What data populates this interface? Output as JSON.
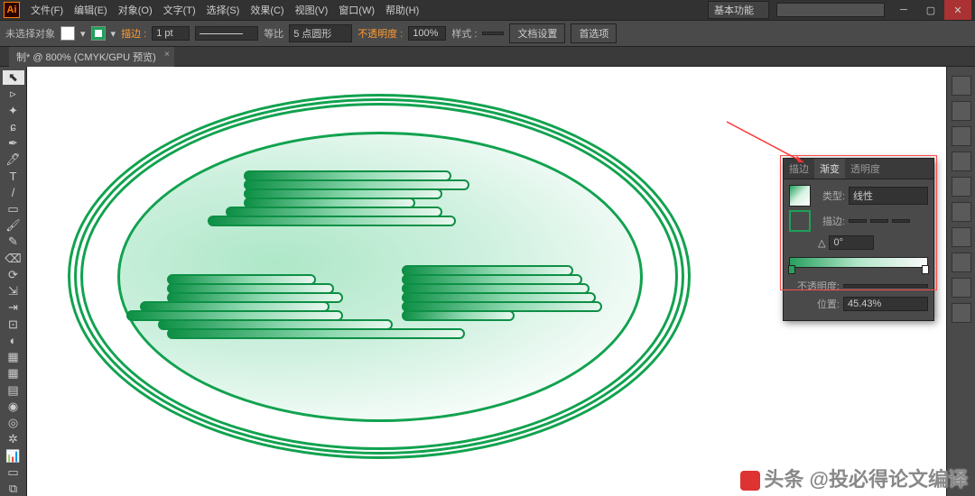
{
  "app": {
    "logo": "Ai"
  },
  "menu": [
    "文件(F)",
    "编辑(E)",
    "对象(O)",
    "文字(T)",
    "选择(S)",
    "效果(C)",
    "视图(V)",
    "窗口(W)",
    "帮助(H)"
  ],
  "workspace": "基本功能",
  "ctrlbar": {
    "no_selection": "未选择对象",
    "stroke_lbl": "描边 :",
    "stroke_val": "1 pt",
    "unif": "等比",
    "brush": "5 点圆形",
    "opacity_lbl": "不透明度 :",
    "opacity_val": "100%",
    "style_lbl": "样式 :",
    "doc_setup": "文档设置",
    "prefs": "首选项"
  },
  "tab": {
    "title": "制* @ 800% (CMYK/GPU 预览)"
  },
  "tools": [
    "▭",
    "⬉",
    "✦",
    "✒",
    "🖊",
    "/",
    "▭",
    "✎",
    "T",
    "◠",
    "▱",
    "🖌",
    "✂",
    "⟳",
    "⇲",
    "▦",
    "◧",
    "📊",
    "≡",
    "🎨",
    "🔍",
    "◨",
    "◧",
    "▦",
    "⊞",
    "⊡"
  ],
  "panel": {
    "tabs": [
      "描边",
      "渐变",
      "透明度"
    ],
    "type_lbl": "类型:",
    "type_val": "线性",
    "stroke_lbl": "描边:",
    "angle_val": "0°",
    "opacity_lbl": "不透明度:",
    "pos_lbl": "位置:",
    "pos_val": "45.43%"
  },
  "watermark": "头条 @投必得论文编译"
}
